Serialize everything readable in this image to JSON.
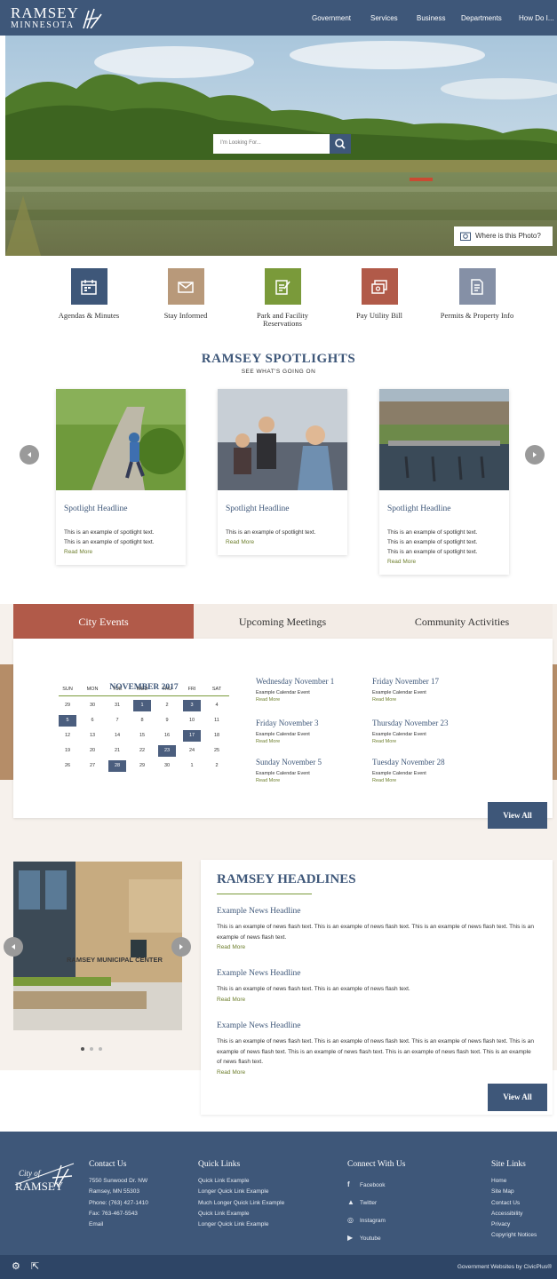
{
  "header": {
    "logo_line1": "RAMSEY",
    "logo_line2": "MINNESOTA",
    "nav": [
      "Government",
      "Services",
      "Business",
      "Departments",
      "How Do I..."
    ]
  },
  "hero": {
    "search_placeholder": "I'm Looking For...",
    "photo_button": "Where is this Photo?"
  },
  "quick_links": [
    {
      "label": "Agendas & Minutes",
      "color": "#3e5779",
      "icon": "calendar-icon"
    },
    {
      "label": "Stay Informed",
      "color": "#b8997a",
      "icon": "envelope-icon"
    },
    {
      "label": "Park and Facility Reservations",
      "color": "#7a9a3a",
      "icon": "edit-form-icon"
    },
    {
      "label": "Pay Utility Bill",
      "color": "#b15a49",
      "icon": "bill-icon"
    },
    {
      "label": "Permits & Property Info",
      "color": "#8590a6",
      "icon": "document-icon"
    }
  ],
  "spotlights": {
    "title": "RAMSEY SPOTLIGHTS",
    "subtitle": "SEE WHAT'S GOING ON",
    "cards": [
      {
        "headline": "Spotlight Headline",
        "lines": [
          "This is an example of spotlight text.",
          "This is an example of spotlight text."
        ],
        "read_more": "Read More"
      },
      {
        "headline": "Spotlight Headline",
        "lines": [
          "This is an example of spotlight text."
        ],
        "read_more": "Read More"
      },
      {
        "headline": "Spotlight Headline",
        "lines": [
          "This is an example of spotlight text.",
          "This is an example of spotlight text.",
          "This is an example of spotlight text."
        ],
        "read_more": "Read More"
      }
    ]
  },
  "events": {
    "tabs": [
      "City Events",
      "Upcoming Meetings",
      "Community Activities"
    ],
    "calendar": {
      "month": "NOVEMBER 2017",
      "weekdays": [
        "SUN",
        "MON",
        "TUE",
        "WED",
        "THU",
        "FRI",
        "SAT"
      ],
      "weeks": [
        [
          "29",
          "30",
          "31",
          "1",
          "2",
          "3",
          "4"
        ],
        [
          "5",
          "6",
          "7",
          "8",
          "9",
          "10",
          "11"
        ],
        [
          "12",
          "13",
          "14",
          "15",
          "16",
          "17",
          "18"
        ],
        [
          "19",
          "20",
          "21",
          "22",
          "23",
          "24",
          "25"
        ],
        [
          "26",
          "27",
          "28",
          "29",
          "30",
          "1",
          "2"
        ]
      ],
      "highlighted": [
        "1",
        "3",
        "5",
        "17",
        "23",
        "28"
      ]
    },
    "list": [
      {
        "date": "Wednesday November 1",
        "title": "Example Calendar Event",
        "read_more": "Read More"
      },
      {
        "date": "Friday November 17",
        "title": "Example Calendar Event",
        "read_more": "Read More"
      },
      {
        "date": "Friday November 3",
        "title": "Example Calendar Event",
        "read_more": "Read More"
      },
      {
        "date": "Thursday November 23",
        "title": "Example Calendar Event",
        "read_more": "Read More"
      },
      {
        "date": "Sunday November 5",
        "title": "Example Calendar Event",
        "read_more": "Read More"
      },
      {
        "date": "Tuesday November 28",
        "title": "Example Calendar Event",
        "read_more": "Read More"
      }
    ],
    "view_all": "View All"
  },
  "headlines": {
    "title": "RAMSEY HEADLINES",
    "items": [
      {
        "headline": "Example News Headline",
        "text": "This is an example of news flash text. This is an example of news flash text. This is an example of news flash text. This is an example of news flash text.",
        "read_more": "Read More"
      },
      {
        "headline": "Example News Headline",
        "text": "This is an example of news flash text. This is an example of news flash text.",
        "read_more": "Read More"
      },
      {
        "headline": "Example News Headline",
        "text": "This is an example of news flash text. This is an example of news flash text. This is an example of news flash text. This is an example of news flash text. This is an example of news flash text. This is an example of news flash text. This is an example of news flash text.",
        "read_more": "Read More"
      }
    ],
    "view_all": "View All",
    "building_sign": "RAMSEY MUNICIPAL CENTER"
  },
  "footer": {
    "logo_line1": "City of",
    "logo_line2": "RAMSEY",
    "contact": {
      "title": "Contact Us",
      "lines": [
        "7550 Sunwood Dr. NW",
        "Ramsey, MN 55303",
        "Phone: (763) 427-1410",
        "Fax: 763-467-5543",
        "Email"
      ]
    },
    "quick_links": {
      "title": "Quick Links",
      "lines": [
        "Quick Link Example",
        "Longer Quick Link Example",
        "Much Longer Quick Link Example",
        "Quick Link Example",
        "Longer Quick Link Example"
      ]
    },
    "connect": {
      "title": "Connect With Us",
      "lines": [
        "Facebook",
        "Twitter",
        "Instagram",
        "Youtube"
      ]
    },
    "site_links": {
      "title": "Site Links",
      "lines": [
        "Home",
        "Site Map",
        "Contact Us",
        "Accessibility",
        "Privacy",
        "Copyright Notices"
      ]
    },
    "credit": "Government Websites by CivicPlus®"
  }
}
